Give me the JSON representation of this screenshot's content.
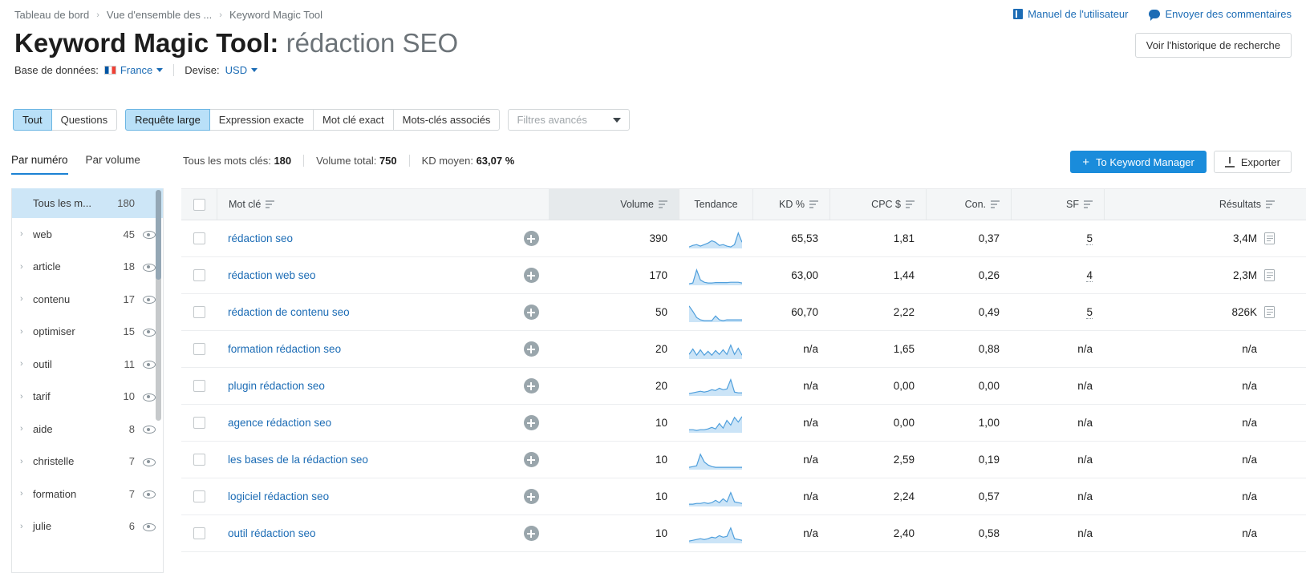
{
  "breadcrumb": {
    "items": [
      "Tableau de bord",
      "Vue d'ensemble des ...",
      "Keyword Magic Tool"
    ],
    "separator": "›"
  },
  "top_links": {
    "manual": "Manuel de l'utilisateur",
    "feedback": "Envoyer des commentaires"
  },
  "header": {
    "title_main": "Keyword Magic Tool: ",
    "title_query": "rédaction SEO",
    "history_button": "Voir l'historique de recherche"
  },
  "meta": {
    "database_label": "Base de données:",
    "database_value": "France",
    "currency_label": "Devise:",
    "currency_value": "USD"
  },
  "filters": {
    "group1": [
      "Tout",
      "Questions"
    ],
    "group1_active": "Tout",
    "group2": [
      "Requête large",
      "Expression exacte",
      "Mot clé exact",
      "Mots-clés associés"
    ],
    "group2_active": "Requête large",
    "advanced_placeholder": "Filtres avancés"
  },
  "subtabs": {
    "items": [
      "Par numéro",
      "Par volume"
    ],
    "active": "Par numéro"
  },
  "stats": {
    "all_keywords_label": "Tous les mots clés:",
    "all_keywords_value": "180",
    "total_volume_label": "Volume total:",
    "total_volume_value": "750",
    "avg_kd_label": "KD moyen:",
    "avg_kd_value": "63,07 %"
  },
  "actions": {
    "keyword_manager": "To Keyword Manager",
    "export": "Exporter"
  },
  "sidebar": {
    "header": {
      "label": "Tous les m...",
      "count": "180"
    },
    "items": [
      {
        "label": "web",
        "count": "45"
      },
      {
        "label": "article",
        "count": "18"
      },
      {
        "label": "contenu",
        "count": "17"
      },
      {
        "label": "optimiser",
        "count": "15"
      },
      {
        "label": "outil",
        "count": "11"
      },
      {
        "label": "tarif",
        "count": "10"
      },
      {
        "label": "aide",
        "count": "8"
      },
      {
        "label": "christelle",
        "count": "7"
      },
      {
        "label": "formation",
        "count": "7"
      },
      {
        "label": "julie",
        "count": "6"
      }
    ]
  },
  "table": {
    "columns": [
      "Mot clé",
      "Volume",
      "Tendance",
      "KD %",
      "CPC $",
      "Con.",
      "SF",
      "Résultats"
    ],
    "rows": [
      {
        "keyword": "rédaction seo",
        "volume": "390",
        "kd": "65,53",
        "cpc": "1,81",
        "con": "0,37",
        "sf": "5",
        "results": "3,4M",
        "has_serp": true,
        "trend": [
          46,
          42,
          40,
          44,
          40,
          36,
          30,
          34,
          42,
          40,
          44,
          46,
          40,
          10,
          34
        ]
      },
      {
        "keyword": "rédaction web seo",
        "volume": "170",
        "kd": "63,00",
        "cpc": "1,44",
        "con": "0,26",
        "sf": "4",
        "results": "2,3M",
        "has_serp": true,
        "trend": [
          46,
          44,
          10,
          36,
          42,
          44,
          44,
          43,
          43,
          43,
          43,
          42,
          42,
          42,
          44
        ]
      },
      {
        "keyword": "rédaction de contenu seo",
        "volume": "50",
        "kd": "60,70",
        "cpc": "2,22",
        "con": "0,49",
        "sf": "5",
        "results": "826K",
        "has_serp": true,
        "trend": [
          8,
          22,
          38,
          44,
          46,
          46,
          46,
          34,
          44,
          46,
          44,
          44,
          44,
          44,
          44
        ]
      },
      {
        "keyword": "formation rédaction seo",
        "volume": "20",
        "kd": "n/a",
        "cpc": "1,65",
        "con": "0,88",
        "sf": "n/a",
        "results": "n/a",
        "has_serp": false,
        "trend": [
          38,
          24,
          40,
          26,
          40,
          30,
          40,
          28,
          38,
          26,
          38,
          14,
          38,
          22,
          40
        ]
      },
      {
        "keyword": "plugin rédaction seo",
        "volume": "20",
        "kd": "n/a",
        "cpc": "0,00",
        "con": "0,00",
        "sf": "n/a",
        "results": "n/a",
        "has_serp": false,
        "trend": [
          44,
          42,
          40,
          38,
          40,
          38,
          34,
          36,
          30,
          34,
          32,
          8,
          40,
          42,
          42
        ]
      },
      {
        "keyword": "agence rédaction seo",
        "volume": "10",
        "kd": "n/a",
        "cpc": "0,00",
        "con": "1,00",
        "sf": "n/a",
        "results": "n/a",
        "has_serp": false,
        "trend": [
          42,
          42,
          44,
          42,
          42,
          40,
          36,
          40,
          26,
          38,
          18,
          30,
          10,
          22,
          8
        ]
      },
      {
        "keyword": "les bases de la rédaction seo",
        "volume": "10",
        "kd": "n/a",
        "cpc": "2,59",
        "con": "0,19",
        "sf": "n/a",
        "results": "n/a",
        "has_serp": false,
        "trend": [
          44,
          42,
          40,
          10,
          30,
          38,
          42,
          44,
          44,
          44,
          44,
          44,
          44,
          44,
          44
        ]
      },
      {
        "keyword": "logiciel rédaction seo",
        "volume": "10",
        "kd": "n/a",
        "cpc": "2,24",
        "con": "0,57",
        "sf": "n/a",
        "results": "n/a",
        "has_serp": false,
        "trend": [
          44,
          44,
          42,
          42,
          40,
          42,
          40,
          34,
          40,
          30,
          38,
          14,
          38,
          40,
          42
        ]
      },
      {
        "keyword": "outil rédaction seo",
        "volume": "10",
        "kd": "n/a",
        "cpc": "2,40",
        "con": "0,58",
        "sf": "n/a",
        "results": "n/a",
        "has_serp": false,
        "trend": [
          44,
          42,
          40,
          38,
          40,
          38,
          34,
          36,
          30,
          34,
          32,
          10,
          38,
          40,
          42
        ]
      }
    ]
  },
  "colors": {
    "link": "#1c6cb5",
    "primary": "#1a8cdb",
    "active_tab": "#b9e0f8",
    "spark_line": "#4f9fdc",
    "spark_fill": "#cbe4f7"
  }
}
